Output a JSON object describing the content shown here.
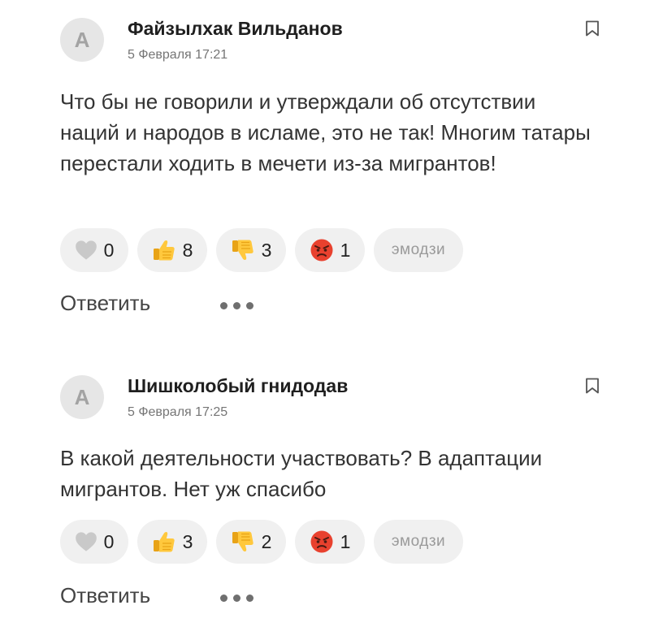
{
  "comments": [
    {
      "avatar_letter": "A",
      "author": "Файзылхак Вильданов",
      "date": "5 Февраля 17:21",
      "text": "Что бы не говорили и утверждали об отсутствии наций и народов в исламе, это не так! Многим татары перестали ходить в мечети из-за мигрантов!",
      "reactions": {
        "heart": "0",
        "thumbs_up": "8",
        "thumbs_down": "3",
        "angry": "1"
      },
      "emoji_label": "эмодзи",
      "reply_label": "Ответить"
    },
    {
      "avatar_letter": "A",
      "author": "Шишколобый гнидодав",
      "date": "5 Февраля 17:25",
      "text": "В какой деятельности участвовать? В адаптации мигрантов. Нет уж спасибо",
      "reactions": {
        "heart": "0",
        "thumbs_up": "3",
        "thumbs_down": "2",
        "angry": "1"
      },
      "emoji_label": "эмодзи",
      "reply_label": "Ответить"
    }
  ],
  "icons": {
    "bookmark": "bookmark-icon",
    "heart": "heart-icon",
    "thumbs_up": "thumbs-up-emoji",
    "thumbs_down": "thumbs-down-emoji",
    "angry": "angry-face-emoji",
    "more": "more-dots-icon"
  },
  "colors": {
    "pill_bg": "#f0f0f0",
    "avatar_bg": "#e6e6e6",
    "emoji_yellow": "#ffc83d",
    "angry_red": "#e8412e"
  }
}
